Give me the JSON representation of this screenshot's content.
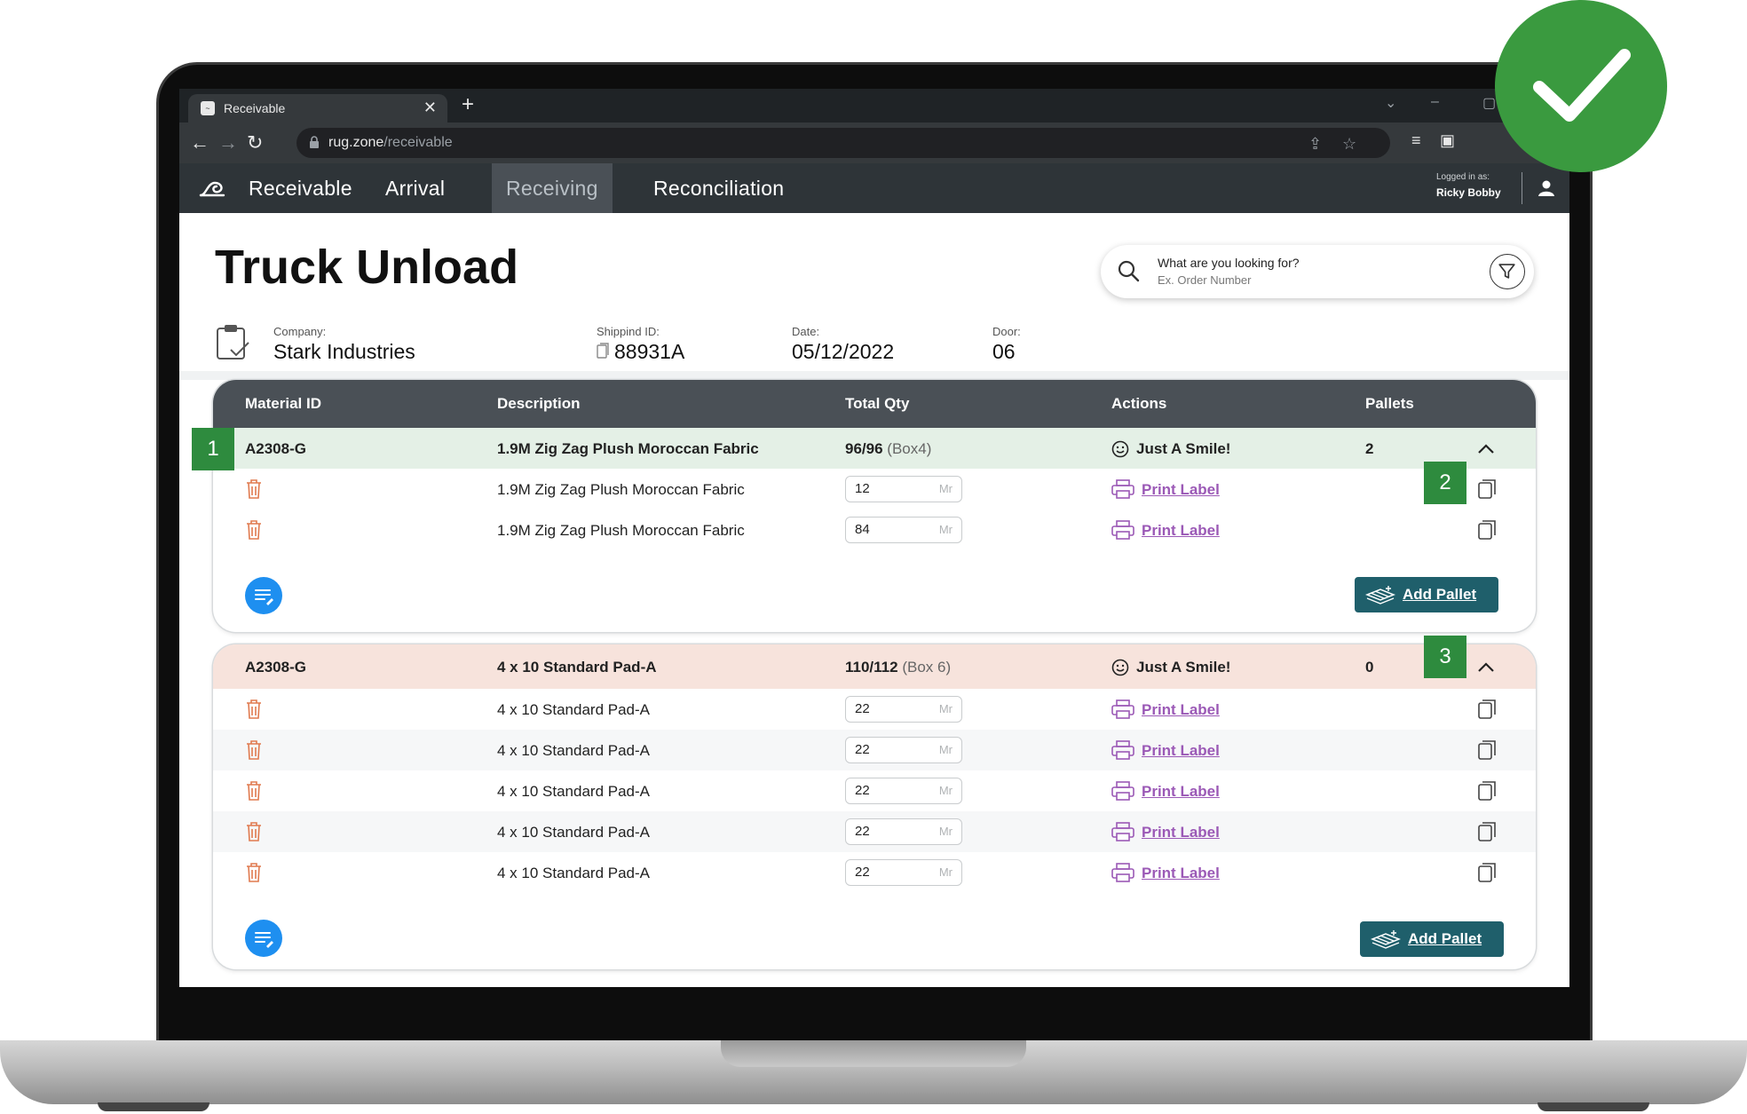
{
  "browser": {
    "tab_title": "Receivable",
    "favicon": "logo-icon",
    "url_host": "rug.zone",
    "url_path": "/receivable"
  },
  "app_nav": {
    "items": [
      "Receivable",
      "Arrival",
      "Receiving",
      "Reconciliation"
    ],
    "active": "Receiving",
    "logged_in_label": "Logged in as:",
    "user_name": "Ricky Bobby"
  },
  "page": {
    "title": "Truck Unload",
    "search_label": "What are you looking for?",
    "search_placeholder": "Ex. Order Number"
  },
  "meta": {
    "company_label": "Company:",
    "company": "Stark Industries",
    "shipping_label": "Shippind ID:",
    "shipping_id": "88931A",
    "date_label": "Date:",
    "date": "05/12/2022",
    "door_label": "Door:",
    "door": "06"
  },
  "table_headers": {
    "material": "Material ID",
    "description": "Description",
    "qty": "Total Qty",
    "actions": "Actions",
    "pallets": "Pallets"
  },
  "groups": [
    {
      "material_id": "A2308-G",
      "description": "1.9M Zig Zag Plush Moroccan Fabric",
      "qty": "96/96",
      "box": "(Box4)",
      "action": "Just A Smile!",
      "pallets": "2",
      "status_color": "#e4f0e6",
      "lines": [
        {
          "description": "1.9M Zig Zag Plush Moroccan Fabric",
          "qty": "12",
          "unit": "Mr",
          "print": "Print Label"
        },
        {
          "description": "1.9M Zig Zag Plush Moroccan Fabric",
          "qty": "84",
          "unit": "Mr",
          "print": "Print Label"
        }
      ],
      "add_pallet": "Add Pallet"
    },
    {
      "material_id": "A2308-G",
      "description": "4 x 10 Standard Pad-A",
      "qty": "110/112",
      "box": "(Box 6)",
      "action": "Just A Smile!",
      "pallets": "0",
      "status_color": "#f7e3dc",
      "lines": [
        {
          "description": "4 x 10 Standard Pad-A",
          "qty": "22",
          "unit": "Mr",
          "print": "Print Label"
        },
        {
          "description": "4 x 10 Standard Pad-A",
          "qty": "22",
          "unit": "Mr",
          "print": "Print Label"
        },
        {
          "description": "4 x 10 Standard Pad-A",
          "qty": "22",
          "unit": "Mr",
          "print": "Print Label"
        },
        {
          "description": "4 x 10 Standard Pad-A",
          "qty": "22",
          "unit": "Mr",
          "print": "Print Label"
        },
        {
          "description": "4 x 10 Standard Pad-A",
          "qty": "22",
          "unit": "Mr",
          "print": "Print Label"
        }
      ],
      "add_pallet": "Add Pallet"
    }
  ],
  "badges": [
    "1",
    "2",
    "3"
  ],
  "colors": {
    "accent": "#1f5f6b",
    "badge": "#2e8b3e",
    "link": "#9b59b6",
    "trash": "#e07a4f"
  }
}
